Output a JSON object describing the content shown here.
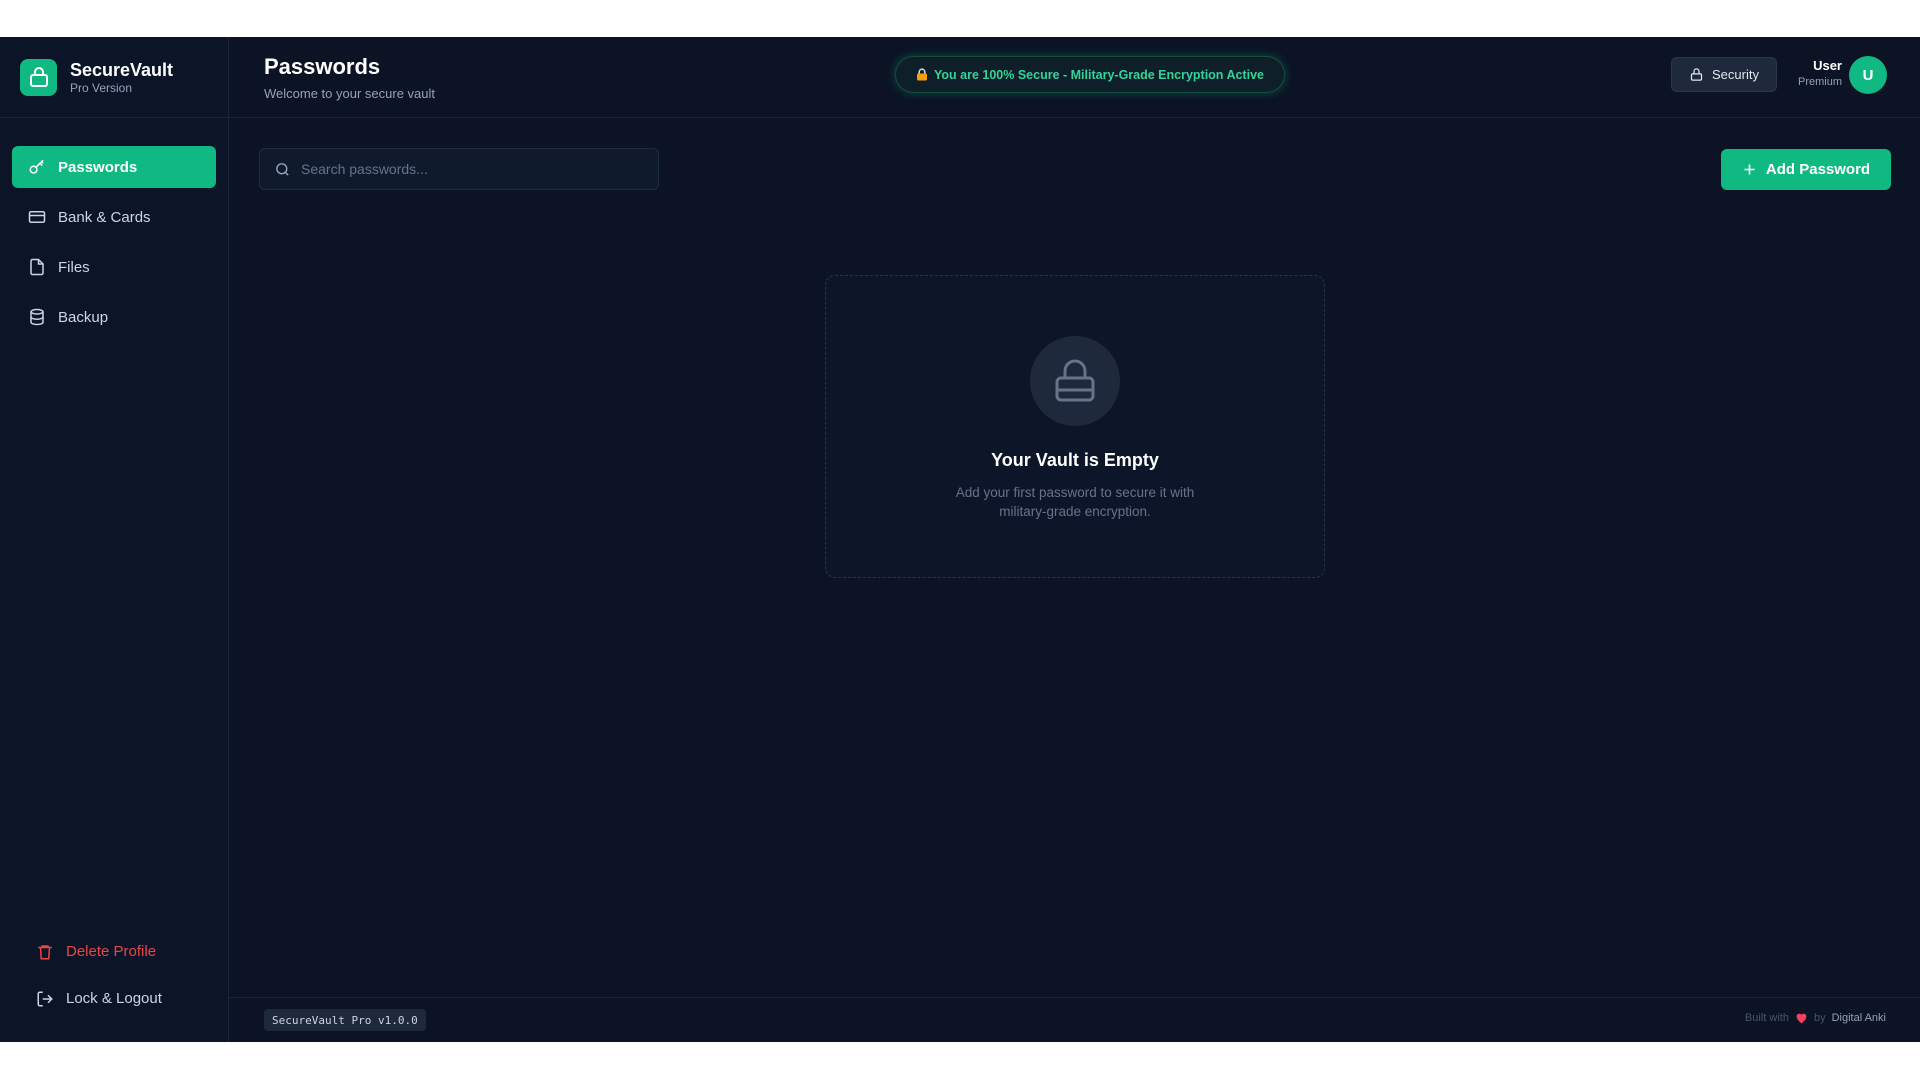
{
  "brand": {
    "name": "SecureVault",
    "sub": "Pro Version",
    "logo_icon": "lock-icon",
    "accent": "#10b981"
  },
  "sidebar": {
    "items": [
      {
        "label": "Passwords",
        "icon": "key-icon",
        "active": true
      },
      {
        "label": "Bank & Cards",
        "icon": "credit-card-icon",
        "active": false
      },
      {
        "label": "Files",
        "icon": "file-icon",
        "active": false
      },
      {
        "label": "Backup",
        "icon": "database-icon",
        "active": false
      }
    ],
    "delete_label": "Delete Profile",
    "logout_label": "Lock & Logout"
  },
  "header": {
    "title": "Passwords",
    "subtitle": "Welcome to your secure vault",
    "banner": "You are 100% Secure - Military-Grade Encryption Active",
    "security_label": "Security",
    "user_name": "User",
    "user_plan": "Premium",
    "avatar_initial": "U"
  },
  "toolbar": {
    "search_placeholder": "Search passwords...",
    "add_label": "Add Password"
  },
  "empty_state": {
    "title": "Your Vault is Empty",
    "description": "Add your first password to secure it with military-grade encryption."
  },
  "footer": {
    "version": "SecureVault Pro v1.0.0",
    "built_prefix": "Built with",
    "built_by": "by",
    "author": "Digital Anki"
  }
}
